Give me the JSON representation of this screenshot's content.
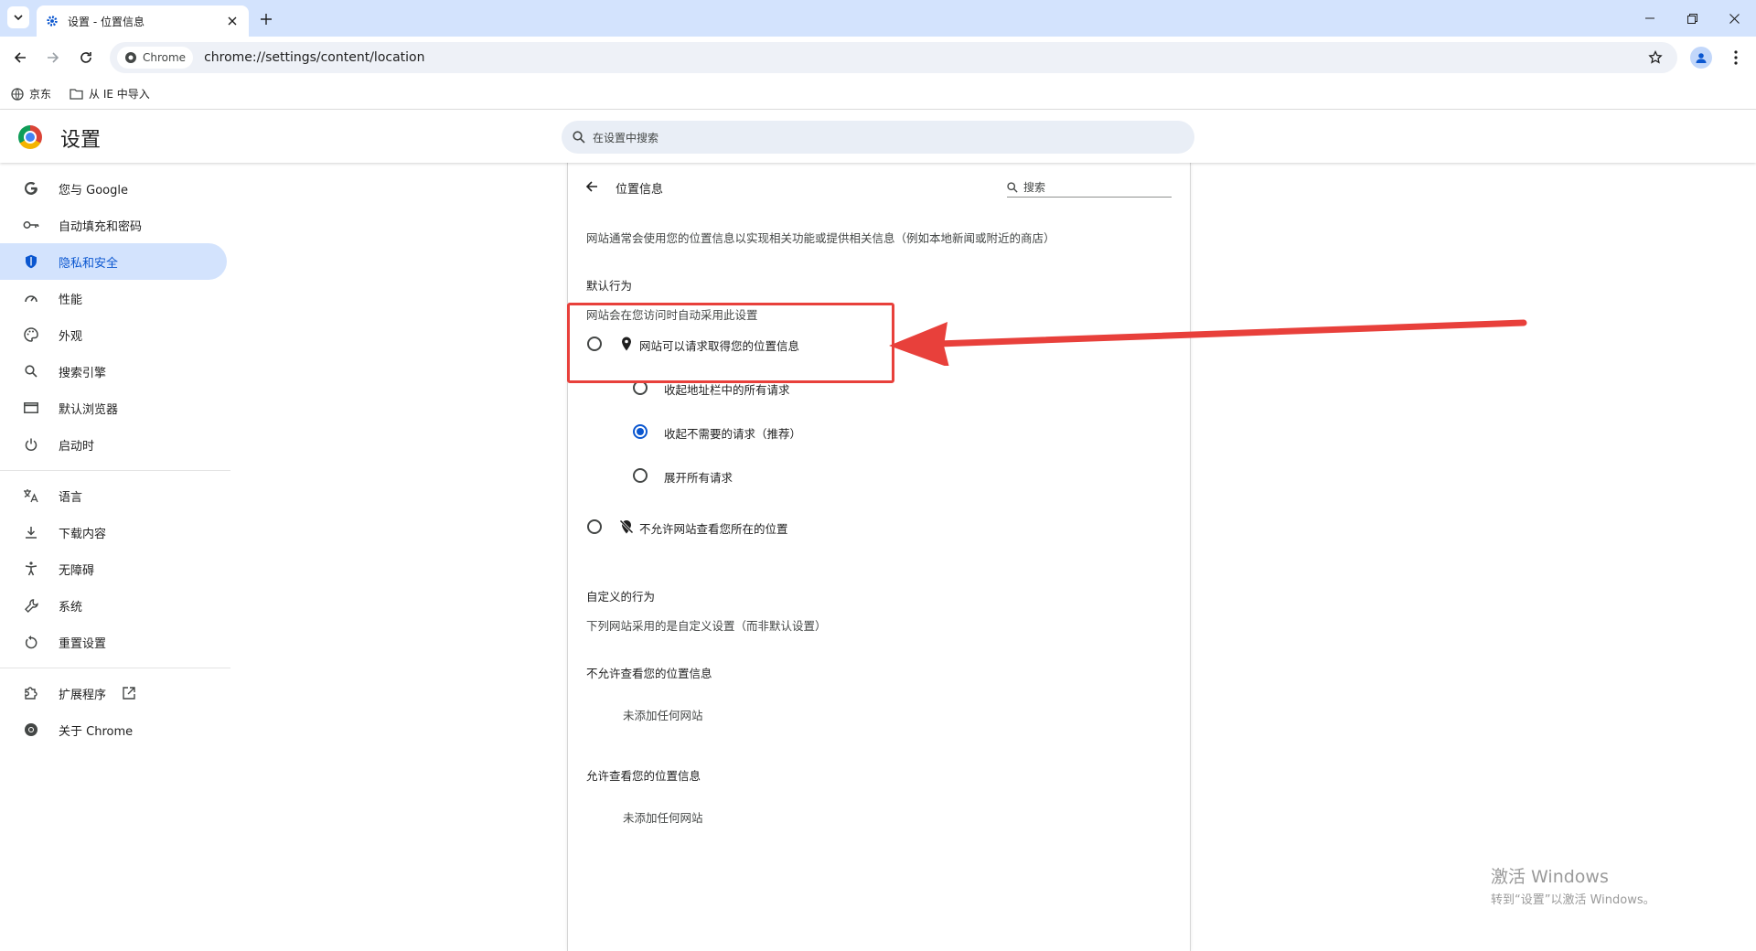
{
  "browser": {
    "tab_title": "设置 - 位置信息",
    "chip_label": "Chrome",
    "url": "chrome://settings/content/location",
    "bookmarks": [
      "京东",
      "从 IE 中导入"
    ]
  },
  "header": {
    "title": "设置",
    "search_placeholder": "在设置中搜索"
  },
  "sidebar": {
    "items": [
      {
        "label": "您与 Google",
        "icon": "google-icon"
      },
      {
        "label": "自动填充和密码",
        "icon": "key-icon"
      },
      {
        "label": "隐私和安全",
        "icon": "shield-icon",
        "active": true
      },
      {
        "label": "性能",
        "icon": "speedometer-icon"
      },
      {
        "label": "外观",
        "icon": "palette-icon"
      },
      {
        "label": "搜索引擎",
        "icon": "search-icon"
      },
      {
        "label": "默认浏览器",
        "icon": "browser-window-icon"
      },
      {
        "label": "启动时",
        "icon": "power-icon"
      },
      {
        "label": "语言",
        "icon": "translate-icon"
      },
      {
        "label": "下载内容",
        "icon": "download-icon"
      },
      {
        "label": "无障碍",
        "icon": "accessibility-icon"
      },
      {
        "label": "系统",
        "icon": "wrench-icon"
      },
      {
        "label": "重置设置",
        "icon": "reset-icon"
      },
      {
        "label": "扩展程序",
        "icon": "extension-icon"
      },
      {
        "label": "关于 Chrome",
        "icon": "chrome-icon"
      }
    ]
  },
  "location": {
    "heading": "位置信息",
    "search_placeholder": "搜索",
    "description": "网站通常会使用您的位置信息以实现相关功能或提供相关信息（例如本地新闻或附近的商店）",
    "default_title": "默认行为",
    "default_subtitle": "网站会在您访问时自动采用此设置",
    "options": {
      "allow": {
        "label": "网站可以请求取得您的位置信息",
        "checked": false
      },
      "sub": [
        {
          "label": "收起地址栏中的所有请求",
          "checked": false
        },
        {
          "label": "收起不需要的请求（推荐）",
          "checked": true
        },
        {
          "label": "展开所有请求",
          "checked": false
        }
      ],
      "block": {
        "label": "不允许网站查看您所在的位置",
        "checked": false
      }
    },
    "custom_title": "自定义的行为",
    "custom_subtitle": "下列网站采用的是自定义设置（而非默认设置）",
    "not_allowed_title": "不允许查看您的位置信息",
    "not_allowed_empty": "未添加任何网站",
    "allowed_title": "允许查看您的位置信息",
    "allowed_empty": "未添加任何网站"
  },
  "watermark": {
    "line1": "激活 Windows",
    "line2": "转到“设置”以激活 Windows。"
  },
  "colors": {
    "accent": "#0b57d0",
    "annotation": "#e8403b",
    "tabstrip": "#d3e3fd"
  }
}
